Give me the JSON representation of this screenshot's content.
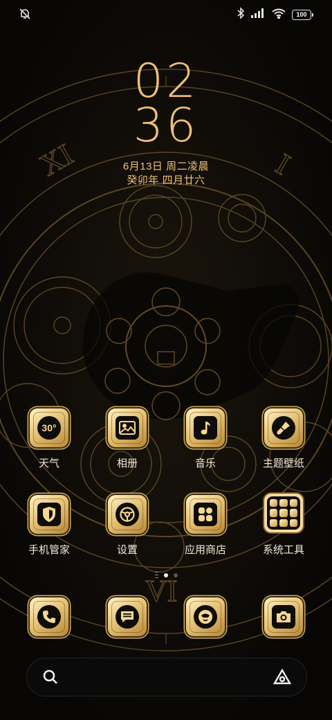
{
  "status_bar": {
    "left_icon": "vibrate-off-icon",
    "right_icons": [
      "bluetooth-icon",
      "signal-icon",
      "wifi-icon",
      "battery-icon"
    ],
    "battery": "100"
  },
  "lockclock": {
    "hour": "02",
    "minute": "36",
    "date": "6月13日 周二凌晨",
    "lunar": "癸卯年 四月廿六"
  },
  "apps_row1": [
    {
      "label": "天气",
      "icon": "weather-icon",
      "badge": "30°"
    },
    {
      "label": "相册",
      "icon": "gallery-icon"
    },
    {
      "label": "音乐",
      "icon": "music-note-icon"
    },
    {
      "label": "主题壁纸",
      "icon": "paint-brush-icon"
    }
  ],
  "apps_row2": [
    {
      "label": "手机管家",
      "icon": "shield-icon"
    },
    {
      "label": "设置",
      "icon": "steering-wheel-icon"
    },
    {
      "label": "应用商店",
      "icon": "app-grid-icon"
    },
    {
      "label": "系统工具",
      "icon": "folder-icon"
    }
  ],
  "dock": [
    {
      "icon": "phone-icon"
    },
    {
      "icon": "message-icon"
    },
    {
      "icon": "browser-icon"
    },
    {
      "icon": "camera-icon"
    }
  ],
  "page_indicator": {
    "pages": 2,
    "current": 1
  },
  "colors": {
    "gold": "#f0c173",
    "gold_light": "#fff2c4",
    "gold_dark": "#b78836",
    "background": "#0b0a08"
  }
}
